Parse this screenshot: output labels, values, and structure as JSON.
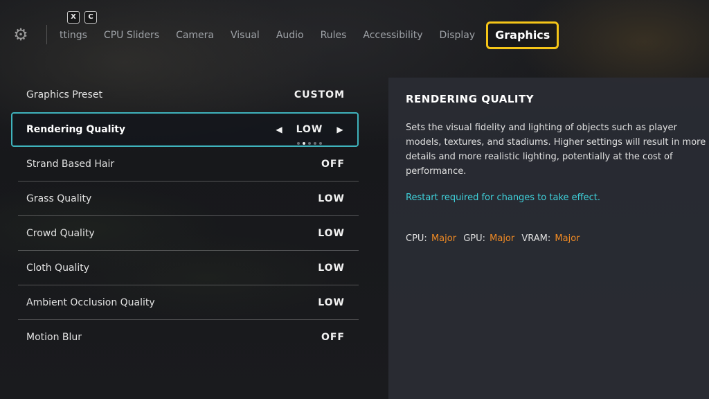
{
  "header": {
    "keys": [
      "X",
      "C"
    ],
    "tabs": [
      {
        "label": "ttings"
      },
      {
        "label": "CPU Sliders"
      },
      {
        "label": "Camera"
      },
      {
        "label": "Visual"
      },
      {
        "label": "Audio"
      },
      {
        "label": "Rules"
      },
      {
        "label": "Accessibility"
      },
      {
        "label": "Display"
      },
      {
        "label": "Graphics"
      }
    ],
    "active_tab": "Graphics"
  },
  "settings": [
    {
      "label": "Graphics Preset",
      "value": "CUSTOM"
    },
    {
      "label": "Rendering Quality",
      "value": "LOW",
      "selected": true,
      "level": 2,
      "levels": 5
    },
    {
      "label": "Strand Based Hair",
      "value": "OFF"
    },
    {
      "label": "Grass Quality",
      "value": "LOW"
    },
    {
      "label": "Crowd Quality",
      "value": "LOW"
    },
    {
      "label": "Cloth Quality",
      "value": "LOW"
    },
    {
      "label": "Ambient Occlusion Quality",
      "value": "LOW"
    },
    {
      "label": "Motion Blur",
      "value": "OFF"
    }
  ],
  "panel": {
    "title": "RENDERING QUALITY",
    "description": "Sets the visual fidelity and lighting of objects such as player models, textures, and stadiums. Higher settings will result in more details and more realistic lighting, potentially at the cost of performance.",
    "restart_note": "Restart required for changes to take effect.",
    "impact": {
      "cpu_label": "CPU:",
      "cpu": "Major",
      "gpu_label": "GPU:",
      "gpu": "Major",
      "vram_label": "VRAM:",
      "vram": "Major"
    }
  },
  "colors": {
    "accent_tab": "#f5c518",
    "selection_border": "#3fb3bd",
    "restart_text": "#3fd2dc",
    "impact_value": "#f08a24"
  }
}
